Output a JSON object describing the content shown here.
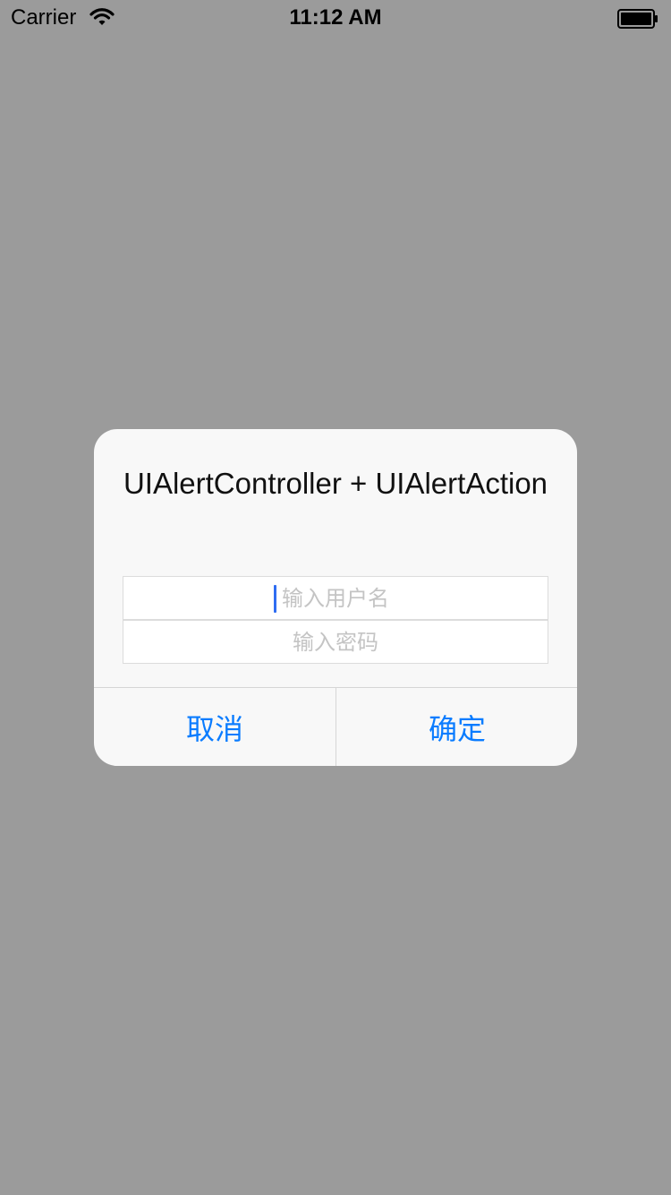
{
  "status_bar": {
    "carrier": "Carrier",
    "time": "11:12 AM",
    "wifi_icon": "wifi-icon",
    "battery_icon": "battery-icon"
  },
  "alert": {
    "title": "UIAlertController + UIAlertAction",
    "username_placeholder": "输入用户名",
    "password_placeholder": "输入密码",
    "cancel_label": "取消",
    "confirm_label": "确定"
  },
  "colors": {
    "overlay_background": "#9b9b9b",
    "alert_background": "#f8f8f8",
    "action_blue": "#0a7cff",
    "caret_blue": "#2f6df2"
  }
}
